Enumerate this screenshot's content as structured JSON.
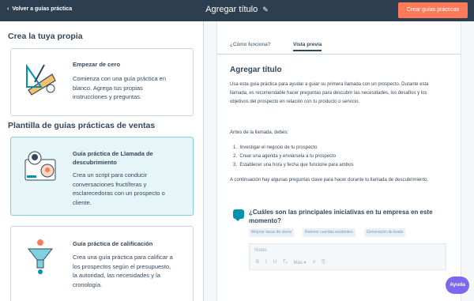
{
  "header": {
    "back_label": "Volver a guías práctica",
    "title": "Agregar título",
    "cta_label": "Crear guías prácticas"
  },
  "left": {
    "section1_title": "Crea la tuya propia",
    "cards1": [
      {
        "title": "Empezar de cero",
        "desc_lines": [
          "Comienza con una guía práctica en",
          "blanco. Agrega tus propias",
          "instrucciones y preguntas."
        ]
      }
    ],
    "section2_title": "Plantilla de guías prácticas de ventas",
    "cards2": [
      {
        "title_lines": [
          "Guía práctica de Llamada de",
          "descubrimiento"
        ],
        "desc_lines": [
          "Crea un script para conducir",
          "conversaciones fructíferas y",
          "esclarecedoras con un prospecto o",
          "cliente."
        ]
      },
      {
        "title_lines": [
          "Guía práctica de calificación"
        ],
        "desc_lines": [
          "Crea una guía práctica para calificar a",
          "los prospectos según el presupuesto,",
          "la autoridad, las necesidades y la",
          "cronología."
        ]
      }
    ]
  },
  "right": {
    "tabs": [
      "¿Cómo funciona?",
      "Vista previa"
    ],
    "preview_title": "Agregar título",
    "intro_lines": [
      "Usa esta guía práctica para ayudar a guiar su primera llamada con un prospecto. Durante esta",
      "llamada, es recomendable hacer preguntas para descubrir las necesidades, los desafíos y los",
      "objetivos del prospecto en relación con tu producto o servicio."
    ],
    "before_call": "Antes de la llamada, debes:",
    "steps": [
      "Investigar el negocio de tu prospecto",
      "Crear una agenda y enviársela a tu prospecto",
      "Establecer una hora y fecha que funcione para ambos"
    ],
    "questions_intro": "A continuación hay algunas preguntas clave para hacer durante tu llamada de descubrimiento.",
    "question": {
      "title_lines": [
        "¿Cuáles son las principales iniciativas en tu empresa en este",
        "momento?"
      ],
      "chips": [
        "Mejorar tasas de cierre",
        "Retener cuentas existentes",
        "Generación de leads"
      ],
      "notes_placeholder": "Notas",
      "toolbar": [
        "B",
        "I",
        "U",
        "Tₓ",
        "Más ▾",
        "≡",
        "⎘"
      ]
    }
  },
  "help_label": "Ayuda",
  "colors": {
    "topbar": "#2d3e50",
    "cta": "#ff7a59",
    "selected_card_bg": "#e5f5f8",
    "selected_card_border": "#7fd1de",
    "help": "#7b68ee",
    "accent": "#0091ae"
  }
}
